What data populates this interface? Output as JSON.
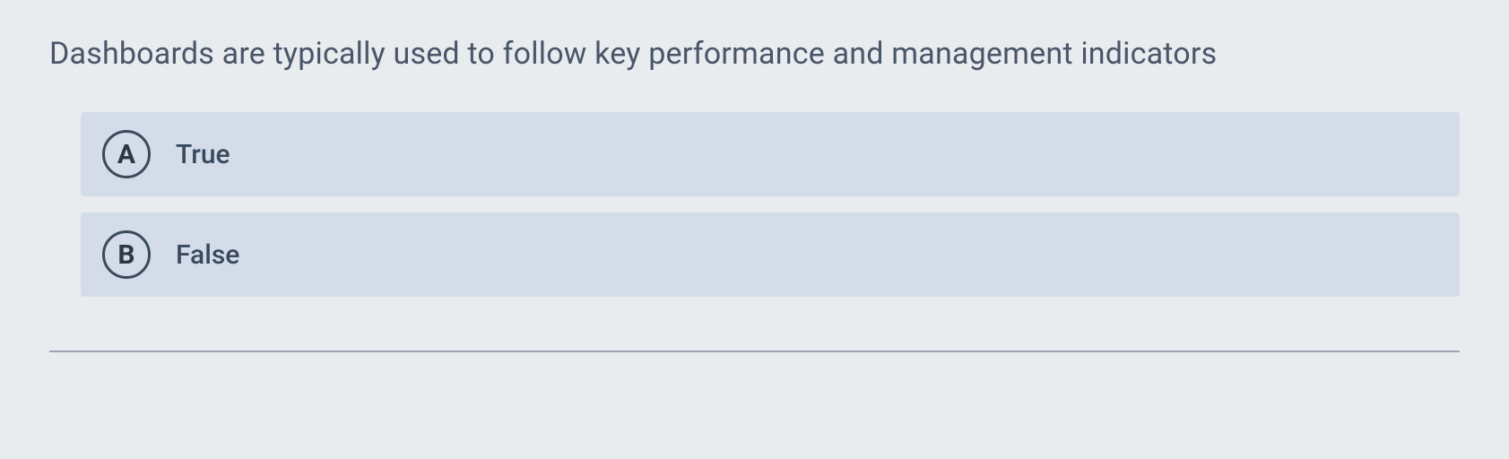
{
  "question": {
    "text": "Dashboards are typically used to follow key performance and management indicators",
    "options": [
      {
        "letter": "A",
        "label": "True"
      },
      {
        "letter": "B",
        "label": "False"
      }
    ]
  }
}
